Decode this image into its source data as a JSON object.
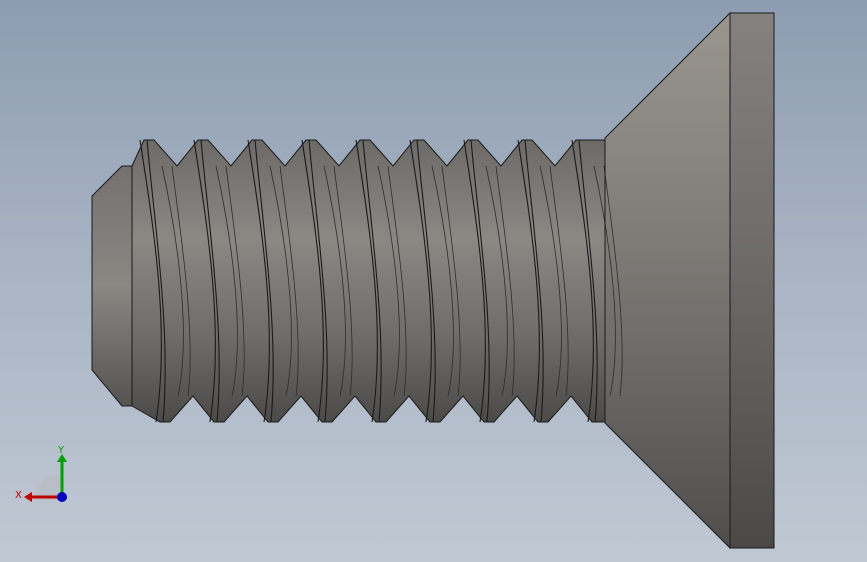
{
  "viewport": {
    "background_top": "#8d9cb1",
    "background_bottom": "#c0c8d3",
    "model": {
      "name": "countersunk-screw",
      "body_color": "#7a7875",
      "edge_color": "#1a1a1a",
      "thread_turns": 9
    },
    "triad": {
      "x_label": "X",
      "y_label": "Y",
      "x_color": "#c00000",
      "y_color": "#00a000",
      "z_color": "#0000c0"
    }
  }
}
